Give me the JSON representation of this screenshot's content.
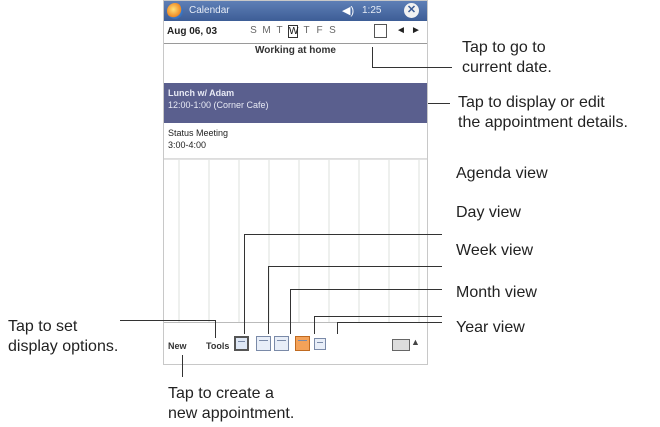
{
  "device": {
    "app_title": "Calendar",
    "clock": "1:25",
    "ok_label": "✕",
    "date_label": "Aug 06, 03",
    "days": [
      "S",
      "M",
      "T",
      "W",
      "T",
      "F",
      "S"
    ],
    "selected_day_index": 3,
    "today_label": "■",
    "prev_label": "◄",
    "next_label": "►",
    "all_day_event": "Working at home",
    "appointments": [
      {
        "title": "Lunch w/ Adam",
        "detail": "12:00-1:00 (Corner Cafe)",
        "selected": true
      },
      {
        "title": "Status Meeting",
        "detail": "3:00-4:00",
        "selected": false
      }
    ],
    "menu": {
      "new": "New",
      "tools": "Tools"
    },
    "keyboard_arrow": "▲"
  },
  "callouts": {
    "current_date": [
      "Tap to go to",
      "current date."
    ],
    "appointment_details": [
      "Tap to display or edit",
      "the appointment details."
    ],
    "agenda_view": "Agenda view",
    "day_view": "Day view",
    "week_view": "Week view",
    "month_view": "Month view",
    "year_view": "Year view",
    "display_options": [
      "Tap to set",
      "display options."
    ],
    "new_appointment": [
      "Tap to create a",
      "new appointment."
    ]
  }
}
